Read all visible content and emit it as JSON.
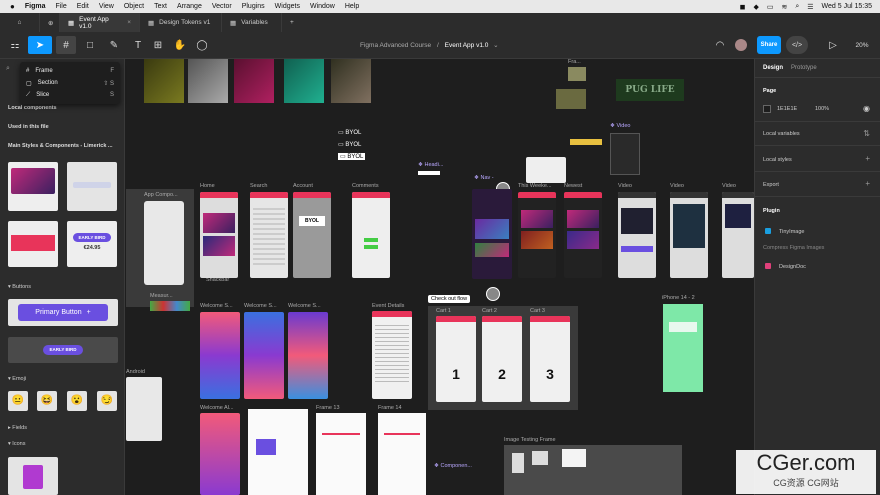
{
  "menubar": {
    "app": "Figma",
    "items": [
      "File",
      "Edit",
      "View",
      "Object",
      "Text",
      "Arrange",
      "Vector",
      "Plugins",
      "Widgets",
      "Window",
      "Help"
    ],
    "clock": "Wed 5 Jul  15:35"
  },
  "tabs": [
    {
      "label": "Event App v1.0",
      "active": true
    },
    {
      "label": "Design Tokens v1",
      "active": false
    },
    {
      "label": "Variables",
      "active": false
    }
  ],
  "toolbar": {
    "breadcrumb_project": "Figma Advanced Course",
    "breadcrumb_file": "Event App v1.0",
    "share_label": "Share",
    "zoom": "20%"
  },
  "tool_menu": [
    {
      "label": "Frame",
      "shortcut": "F"
    },
    {
      "label": "Section",
      "shortcut": "⇧ S"
    },
    {
      "label": "Slice",
      "shortcut": "S"
    }
  ],
  "left_panel": {
    "local_components": "Local components",
    "used_in_file": "Used in this file",
    "library": "Main Styles & Components - Limerick ...",
    "card_badge": "EARLY BIRD",
    "card_price": "€24.95",
    "buttons_section": "Buttons",
    "primary_button": "Primary Button",
    "early_bird_button": "EARLY BIRD",
    "emoji_section": "Emoji",
    "fields_section": "Fields",
    "icons_section": "Icons"
  },
  "right_panel": {
    "tab_design": "Design",
    "tab_prototype": "Prototype",
    "page_heading": "Page",
    "page_color": "1E1E1E",
    "page_opacity": "100%",
    "local_variables": "Local variables",
    "local_styles": "Local styles",
    "export": "Export",
    "plugin_heading": "Plugin",
    "plugin_1": "TinyImage",
    "plugin_1_sub": "Compress Figma Images",
    "plugin_2": "DesignDoc"
  },
  "canvas": {
    "labels": {
      "app_components": "App Compo...",
      "home": "Home",
      "search": "Search",
      "account": "Account",
      "comments": "Comments",
      "nav": "Nav -",
      "this_weekend": "This Weeke...",
      "newest": "Newest",
      "video1": "Video",
      "video2": "Video",
      "video3": "Video",
      "video_top": "Video",
      "heading": "Headi...",
      "fra": "Fra...",
      "checkout_flow": "Check out flow",
      "cart1": "Cart 1",
      "cart2": "Cart 2",
      "cart3": "Cart 3",
      "event_details": "Event Details",
      "iphone": "iPhone 14 - 2",
      "welcome1": "Welcome S...",
      "welcome2": "Welcome S...",
      "welcome3": "Welcome S...",
      "welcome_al": "Welcome Al...",
      "frame13": "Frame 13",
      "frame14": "Frame 14",
      "android": "Android",
      "image_testing": "Image Testing Frame",
      "components": "Componen...",
      "measure": "Measur...",
      "byol": "BYOL",
      "pug_life": "PUG LIFE",
      "snackbar": "Snackbar",
      "cart_num_1": "1",
      "cart_num_2": "2",
      "cart_num_3": "3"
    }
  },
  "colors": {
    "accent": "#0d99ff",
    "brand_red": "#e8345a",
    "purple": "#6a4fe0",
    "bg": "#1e1e1e"
  },
  "watermark": {
    "main": "CGer.com",
    "sub": "CG资源 CG网站"
  }
}
